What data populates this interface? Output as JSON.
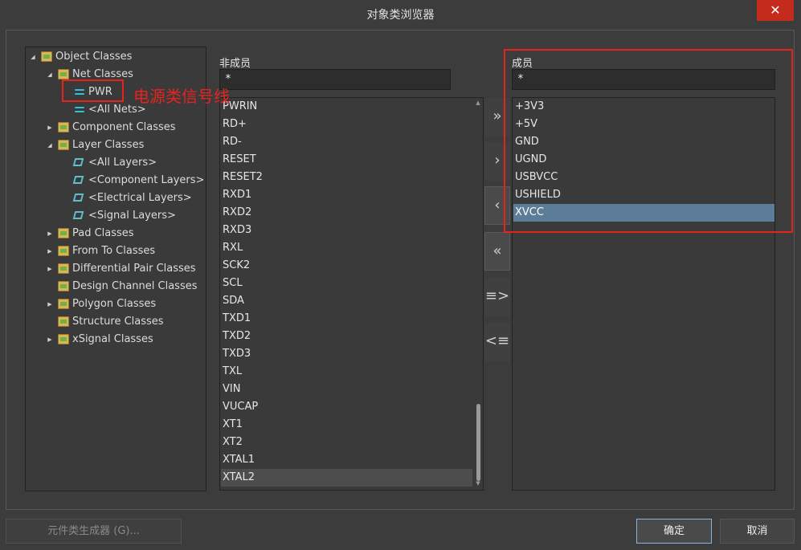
{
  "window": {
    "title": "对象类浏览器",
    "close_glyph": "✕"
  },
  "tree": [
    {
      "level": 0,
      "expanded": true,
      "icon": "object-classes-icon",
      "label": "Object Classes"
    },
    {
      "level": 1,
      "expanded": true,
      "icon": "net-classes-icon",
      "label": "Net Classes"
    },
    {
      "level": 2,
      "expanded": null,
      "icon": "net-icon",
      "label": "PWR"
    },
    {
      "level": 2,
      "expanded": null,
      "icon": "net-icon",
      "label": "<All Nets>"
    },
    {
      "level": 1,
      "expanded": false,
      "icon": "component-classes-icon",
      "label": "Component Classes"
    },
    {
      "level": 1,
      "expanded": true,
      "icon": "layer-classes-icon",
      "label": "Layer Classes"
    },
    {
      "level": 2,
      "expanded": null,
      "icon": "layer-icon",
      "label": "<All Layers>"
    },
    {
      "level": 2,
      "expanded": null,
      "icon": "layer-icon",
      "label": "<Component Layers>"
    },
    {
      "level": 2,
      "expanded": null,
      "icon": "layer-icon",
      "label": "<Electrical Layers>"
    },
    {
      "level": 2,
      "expanded": null,
      "icon": "layer-icon",
      "label": "<Signal Layers>"
    },
    {
      "level": 1,
      "expanded": false,
      "icon": "pad-classes-icon",
      "label": "Pad Classes"
    },
    {
      "level": 1,
      "expanded": false,
      "icon": "from-to-classes-icon",
      "label": "From To Classes"
    },
    {
      "level": 1,
      "expanded": false,
      "icon": "diff-pair-classes-icon",
      "label": "Differential Pair Classes"
    },
    {
      "level": 1,
      "expanded": null,
      "icon": "design-channel-classes-icon",
      "label": "Design Channel Classes"
    },
    {
      "level": 1,
      "expanded": false,
      "icon": "polygon-classes-icon",
      "label": "Polygon Classes"
    },
    {
      "level": 1,
      "expanded": null,
      "icon": "structure-classes-icon",
      "label": "Structure Classes"
    },
    {
      "level": 1,
      "expanded": false,
      "icon": "xsignal-classes-icon",
      "label": "xSignal Classes"
    }
  ],
  "non_members": {
    "label": "非成员",
    "filter": "*",
    "items": [
      "PWRIN",
      "RD+",
      "RD-",
      "RESET",
      "RESET2",
      "RXD1",
      "RXD2",
      "RXD3",
      "RXL",
      "SCK2",
      "SCL",
      "SDA",
      "TXD1",
      "TXD2",
      "TXD3",
      "TXL",
      "VIN",
      "VUCAP",
      "XT1",
      "XT2",
      "XTAL1",
      "XTAL2"
    ],
    "selected": "XTAL2"
  },
  "members": {
    "label": "成员",
    "filter": "*",
    "items": [
      "+3V3",
      "+5V",
      "GND",
      "UGND",
      "USBVCC",
      "USHIELD",
      "XVCC"
    ],
    "selected": "XVCC"
  },
  "move_buttons": [
    {
      "name": "add-all-button",
      "glyph": "»"
    },
    {
      "name": "add-selected-button",
      "glyph": "›"
    },
    {
      "name": "remove-selected-button",
      "glyph": "‹"
    },
    {
      "name": "remove-all-button",
      "glyph": "«"
    },
    {
      "name": "add-filtered-button",
      "glyph": "≡>"
    },
    {
      "name": "remove-filtered-button",
      "glyph": "<≡"
    }
  ],
  "buttons": {
    "generator": "元件类生成器 (G)...",
    "ok": "确定",
    "cancel": "取消"
  },
  "annotation": {
    "text": "电源类信号线"
  },
  "colors": {
    "annotation_red": "#e6231e",
    "selection_blue": "#5d7c98"
  }
}
